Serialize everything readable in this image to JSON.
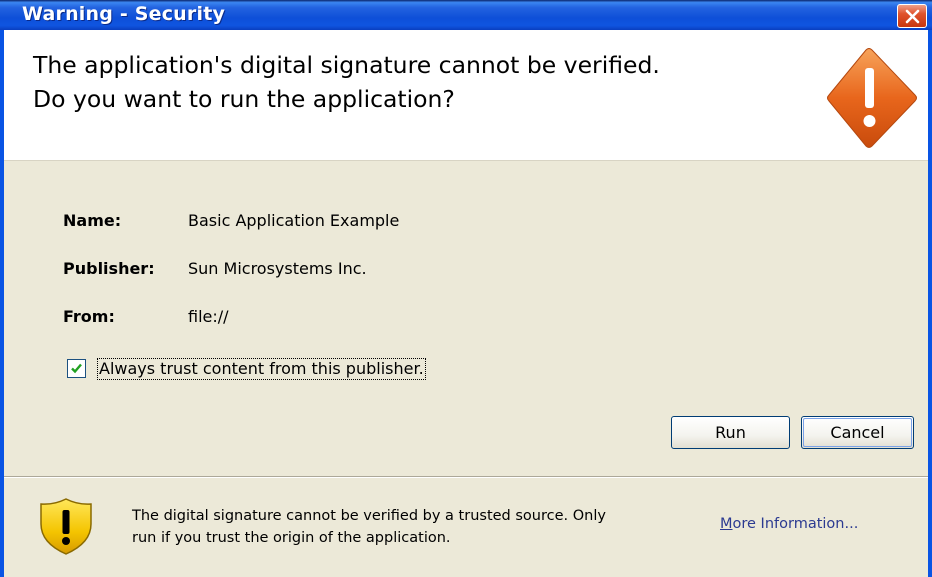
{
  "window": {
    "title": "Warning - Security",
    "close_icon": "close-icon"
  },
  "header": {
    "headline_line1": "The application's digital signature cannot be verified.",
    "headline_line2": "Do you want to run the application?",
    "icon": "warning-diamond-icon"
  },
  "details": {
    "name_label": "Name:",
    "name_value": "Basic Application Example",
    "publisher_label": "Publisher:",
    "publisher_value": "Sun Microsystems Inc.",
    "from_label": "From:",
    "from_value": "file://"
  },
  "trust_checkbox": {
    "label": "Always trust content from this publisher.",
    "checked": true
  },
  "buttons": {
    "run_label": "Run",
    "cancel_label": "Cancel"
  },
  "footer": {
    "icon": "shield-warning-icon",
    "message_line1": "The digital signature cannot be verified by a trusted source.  Only",
    "message_line2": "run if you trust the origin of the application.",
    "more_info_first": "M",
    "more_info_rest": "ore Information..."
  },
  "colors": {
    "titlebar": "#0a4fd8",
    "close_button": "#e0532d",
    "warning_orange": "#e8661c",
    "shield_yellow": "#f4c400",
    "dialog_bg": "#ece9d8",
    "link": "#2b3a91"
  }
}
